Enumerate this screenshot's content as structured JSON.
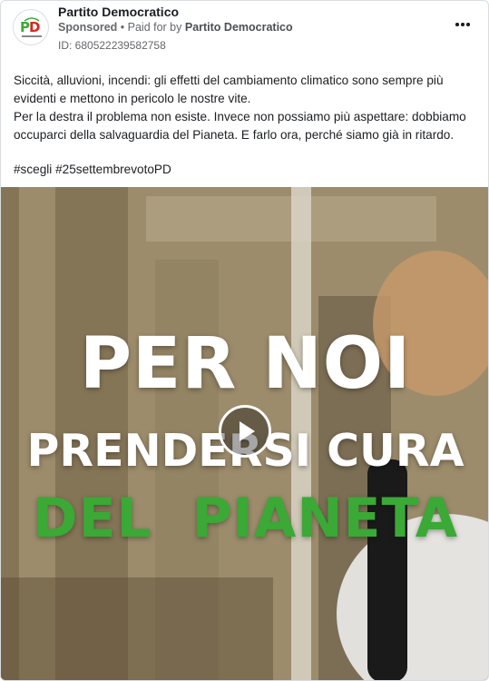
{
  "post": {
    "page_name": "Partito Democratico",
    "sponsored_label": "Sponsored",
    "separator": " • ",
    "paid_for_prefix": "Paid for by ",
    "paid_for_by": "Partito Democratico",
    "ad_id": "ID: 680522239582758",
    "avatar_icon": "pd-logo-icon",
    "menu_icon": "more-options-icon"
  },
  "body": {
    "paragraph_1": "Siccità, alluvioni, incendi: gli effetti del cambiamento climatico sono sempre più evidenti e mettono in pericolo le nostre vite.",
    "paragraph_2": "Per la destra il problema non esiste. Invece non possiamo più aspettare: dobbiamo occuparci della salvaguardia del Pianeta. E farlo ora, perché siamo già in ritardo.",
    "hashtags": "#scegli #25settembrevotoPD"
  },
  "media": {
    "line_1": "PER NOI",
    "line_2": "PRENDERSI CURA",
    "line_3_part_1": "DEL",
    "line_3_part_2": "PIANETA",
    "accent_color": "#3aa935",
    "play_icon": "play-icon"
  }
}
